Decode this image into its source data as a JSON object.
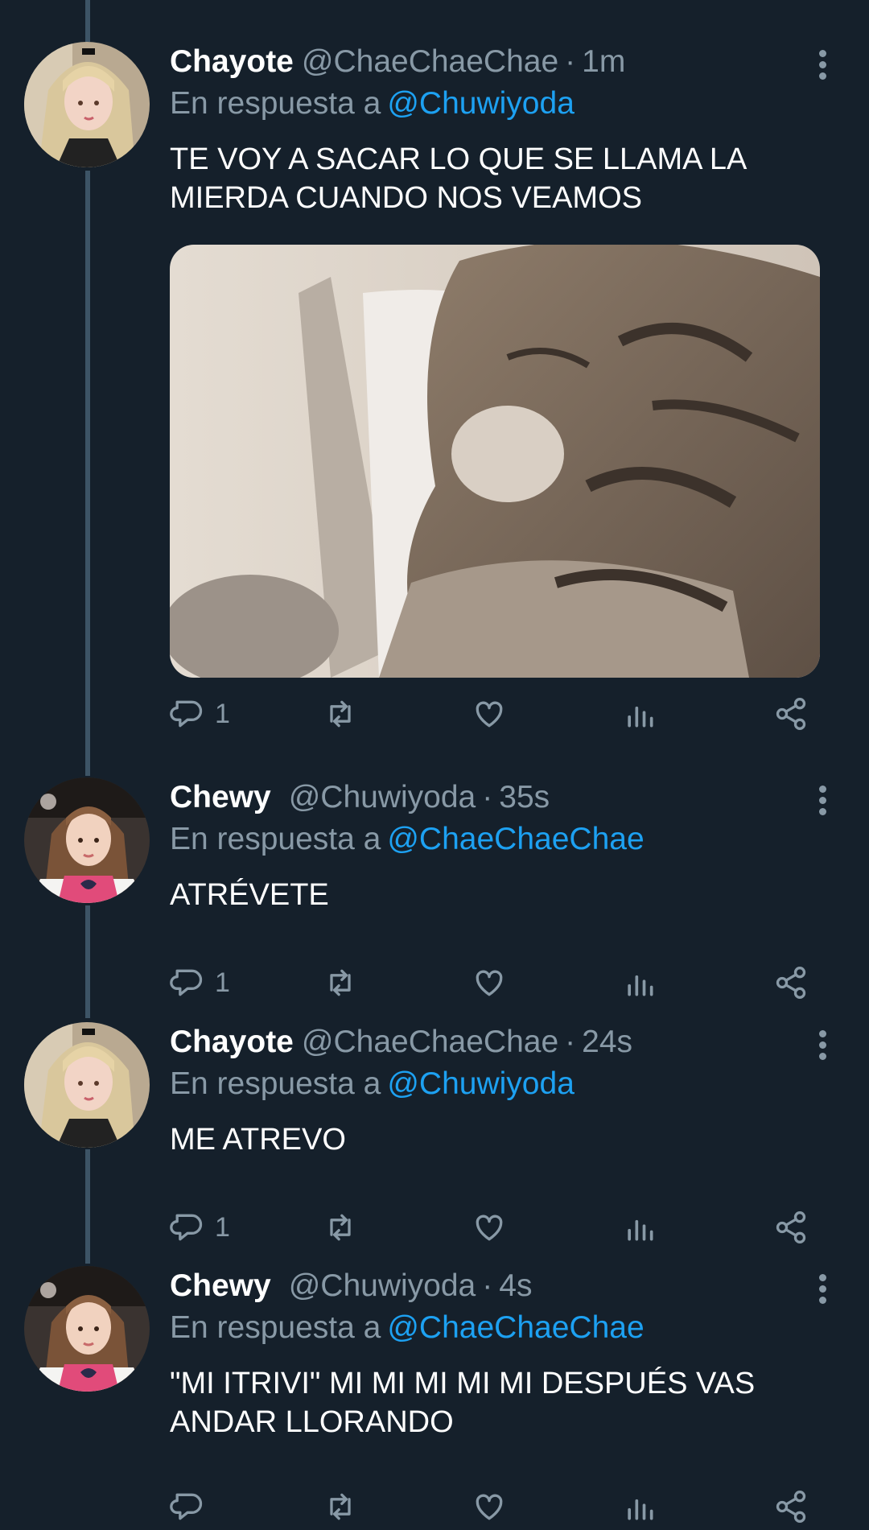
{
  "tweets": [
    {
      "name": "Chayote",
      "handle": "@ChaeChaeChae",
      "time": "1m",
      "reply_label": "En respuesta a",
      "reply_to": "@Chuwiyoda",
      "text": "TE VOY A SACAR LO QUE SE LLAMA LA MIERDA CUANDO NOS VEAMOS",
      "reply_count": "1",
      "has_media": true
    },
    {
      "name": "Chewy",
      "handle": "@Chuwiyoda",
      "time": "35s",
      "reply_label": "En respuesta a",
      "reply_to": "@ChaeChaeChae",
      "text": "ATRÉVETE",
      "reply_count": "1"
    },
    {
      "name": "Chayote",
      "handle": "@ChaeChaeChae",
      "time": "24s",
      "reply_label": "En respuesta a",
      "reply_to": "@Chuwiyoda",
      "text": "ME ATREVO",
      "reply_count": "1"
    },
    {
      "name": "Chewy",
      "handle": "@Chuwiyoda",
      "time": "4s",
      "reply_label": "En respuesta a",
      "reply_to": "@ChaeChaeChae",
      "text": "\"MI ITRIVI\" MI MI MI MI MI DESPUÉS VAS ANDAR LLORANDO",
      "reply_count": ""
    }
  ],
  "icons": [
    "reply-icon",
    "retweet-icon",
    "like-icon",
    "analytics-icon",
    "share-icon",
    "more-options-icon"
  ],
  "colors": {
    "background": "#15202b",
    "secondary_text": "#8899a6",
    "link": "#1da1f2",
    "thread_line": "#3d5466"
  }
}
